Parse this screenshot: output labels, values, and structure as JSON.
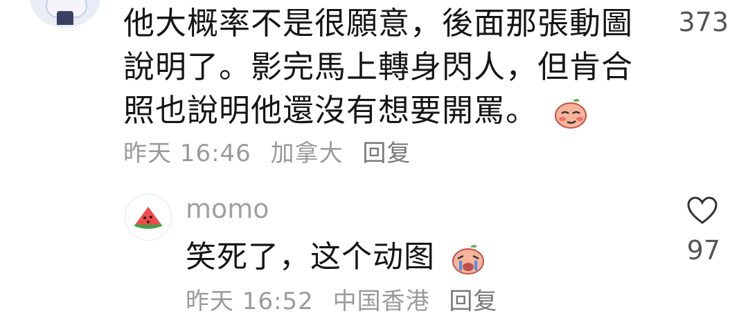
{
  "comment": {
    "lines": [
      "他大概率不是很願意，後面那張動圖",
      "說明了。影完馬上轉身閃人，但肯合",
      "照也說明他還沒有想要開罵。"
    ],
    "time": "昨天 16:46",
    "location": "加拿大",
    "reply_label": "回复",
    "like_count": "373",
    "emoji": "smirk-peach-emoji"
  },
  "reply": {
    "username": "momo",
    "text": "笑死了，这个动图",
    "time": "昨天 16:52",
    "location": "中国香港",
    "reply_label": "回复",
    "like_count": "97",
    "emoji": "crying-laughing-peach-emoji",
    "avatar": "watermelon-icon"
  },
  "colors": {
    "text": "#151515",
    "meta": "#9a9a9a",
    "count": "#555555"
  }
}
